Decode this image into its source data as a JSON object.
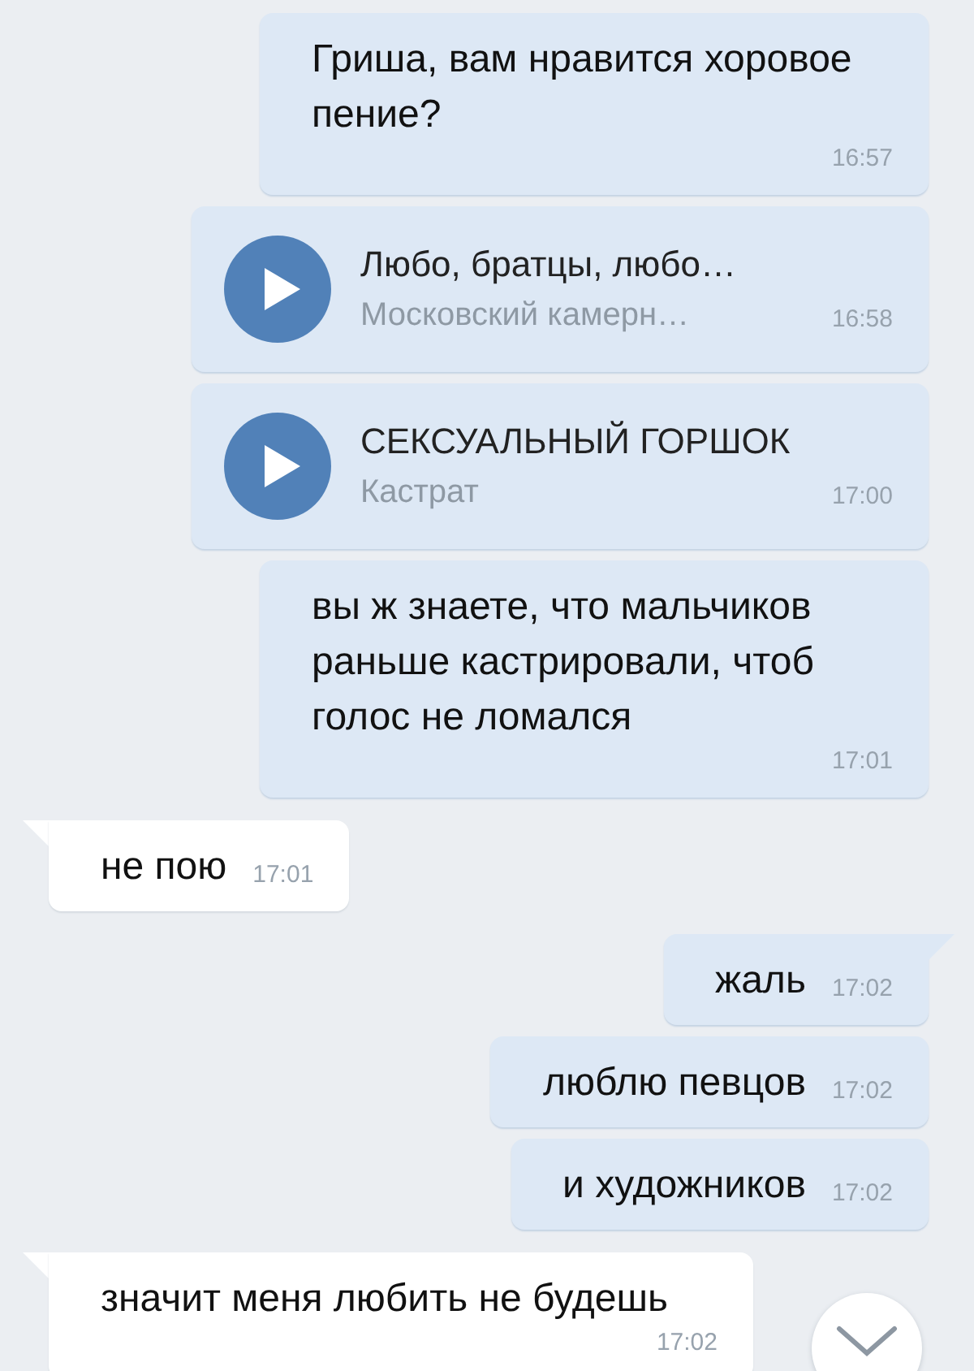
{
  "messages": [
    {
      "kind": "text",
      "outgoing": true,
      "tail": false,
      "text": "Гриша, вам нравится хоровое пение?",
      "time": "16:57"
    },
    {
      "kind": "audio",
      "outgoing": true,
      "title": "Любо, братцы, любо…",
      "artist": "Московский камерн…",
      "time": "16:58"
    },
    {
      "kind": "audio",
      "outgoing": true,
      "title": "СЕКСУАЛЬНЫЙ ГОРШОК",
      "artist": "Кастрат",
      "time": "17:00"
    },
    {
      "kind": "text",
      "outgoing": true,
      "tail": false,
      "text": "вы ж знаете, что мальчиков раньше кастрировали, чтоб голос не ломался",
      "time": "17:01"
    },
    {
      "kind": "text",
      "outgoing": false,
      "tail": true,
      "text": "не пою",
      "time": "17:01"
    },
    {
      "kind": "text",
      "outgoing": true,
      "tail": true,
      "text": "жаль",
      "time": "17:02"
    },
    {
      "kind": "text",
      "outgoing": true,
      "tail": false,
      "text": "люблю певцов",
      "time": "17:02"
    },
    {
      "kind": "text",
      "outgoing": true,
      "tail": false,
      "text": "и художников",
      "time": "17:02"
    },
    {
      "kind": "text",
      "outgoing": false,
      "tail": true,
      "text": "значит меня любить не будешь",
      "time": "17:02"
    }
  ]
}
